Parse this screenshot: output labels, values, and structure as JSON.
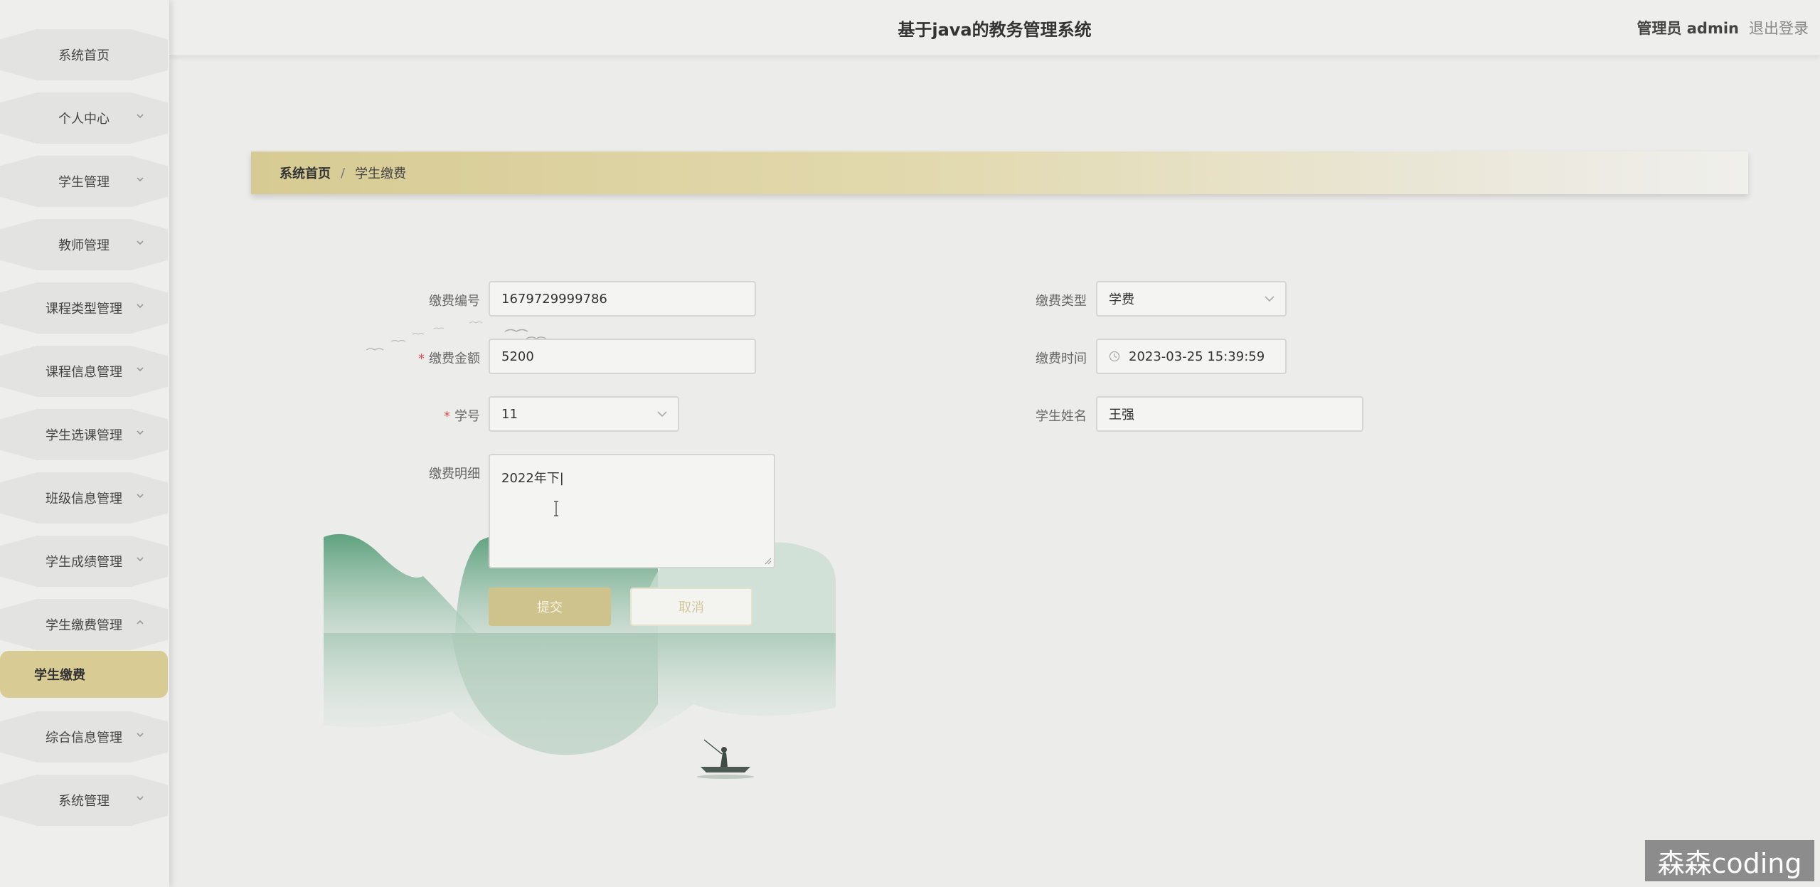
{
  "app": {
    "title": "基于java的教务管理系统",
    "user_role": "管理员 admin",
    "logout": "退出登录"
  },
  "sidebar": {
    "items": [
      {
        "label": "系统首页",
        "has_arrow": false
      },
      {
        "label": "个人中心",
        "has_arrow": true
      },
      {
        "label": "学生管理",
        "has_arrow": true
      },
      {
        "label": "教师管理",
        "has_arrow": true
      },
      {
        "label": "课程类型管理",
        "has_arrow": true
      },
      {
        "label": "课程信息管理",
        "has_arrow": true
      },
      {
        "label": "学生选课管理",
        "has_arrow": true
      },
      {
        "label": "班级信息管理",
        "has_arrow": true
      },
      {
        "label": "学生成绩管理",
        "has_arrow": true
      },
      {
        "label": "学生缴费管理",
        "has_arrow": true,
        "expanded": true
      },
      {
        "label": "综合信息管理",
        "has_arrow": true
      },
      {
        "label": "系统管理",
        "has_arrow": true
      }
    ],
    "active_sub": "学生缴费"
  },
  "breadcrumb": {
    "home": "系统首页",
    "separator": "/",
    "current": "学生缴费"
  },
  "form": {
    "payment_no": {
      "label": "缴费编号",
      "value": "1679729999786"
    },
    "payment_type": {
      "label": "缴费类型",
      "value": "学费"
    },
    "amount": {
      "label": "缴费金额",
      "value": "5200",
      "required": "*"
    },
    "payment_time": {
      "label": "缴费时间",
      "value": "2023-03-25 15:39:59"
    },
    "student_no": {
      "label": "学号",
      "value": "11",
      "required": "*"
    },
    "student_name": {
      "label": "学生姓名",
      "value": "王强"
    },
    "detail": {
      "label": "缴费明细",
      "value": "2022年下|"
    },
    "submit": "提交",
    "cancel": "取消"
  },
  "watermark": "森森coding",
  "colors": {
    "accent": "#d8cc94",
    "background": "#ececea",
    "required": "#e5484d"
  }
}
